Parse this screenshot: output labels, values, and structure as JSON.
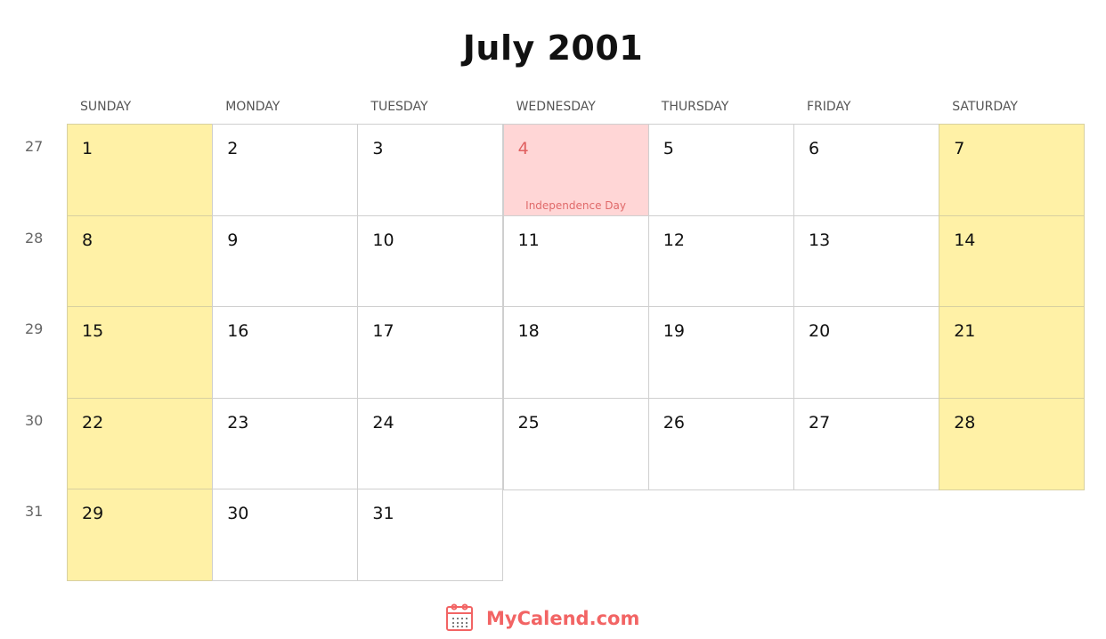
{
  "title": "July 2001",
  "weekdays": [
    "SUNDAY",
    "MONDAY",
    "TUESDAY",
    "WEDNESDAY",
    "THURSDAY",
    "FRIDAY",
    "SATURDAY"
  ],
  "week_numbers": [
    "27",
    "28",
    "29",
    "30",
    "31"
  ],
  "days": [
    {
      "d": "1",
      "weekend": true
    },
    {
      "d": "2"
    },
    {
      "d": "3"
    },
    {
      "d": "4",
      "holiday": "Independence Day"
    },
    {
      "d": "5"
    },
    {
      "d": "6"
    },
    {
      "d": "7",
      "weekend": true
    },
    {
      "d": "8",
      "weekend": true
    },
    {
      "d": "9"
    },
    {
      "d": "10"
    },
    {
      "d": "11"
    },
    {
      "d": "12"
    },
    {
      "d": "13"
    },
    {
      "d": "14",
      "weekend": true
    },
    {
      "d": "15",
      "weekend": true
    },
    {
      "d": "16"
    },
    {
      "d": "17"
    },
    {
      "d": "18"
    },
    {
      "d": "19"
    },
    {
      "d": "20"
    },
    {
      "d": "21",
      "weekend": true
    },
    {
      "d": "22",
      "weekend": true
    },
    {
      "d": "23"
    },
    {
      "d": "24"
    },
    {
      "d": "25"
    },
    {
      "d": "26"
    },
    {
      "d": "27"
    },
    {
      "d": "28",
      "weekend": true
    },
    {
      "d": "29",
      "weekend": true
    },
    {
      "d": "30"
    },
    {
      "d": "31"
    }
  ],
  "footer": {
    "brand": "MyCalend.com",
    "icon": "calendar-icon"
  },
  "colors": {
    "weekend": "#fff1a6",
    "holiday": "#ffd6d6",
    "brand": "#f26464"
  }
}
